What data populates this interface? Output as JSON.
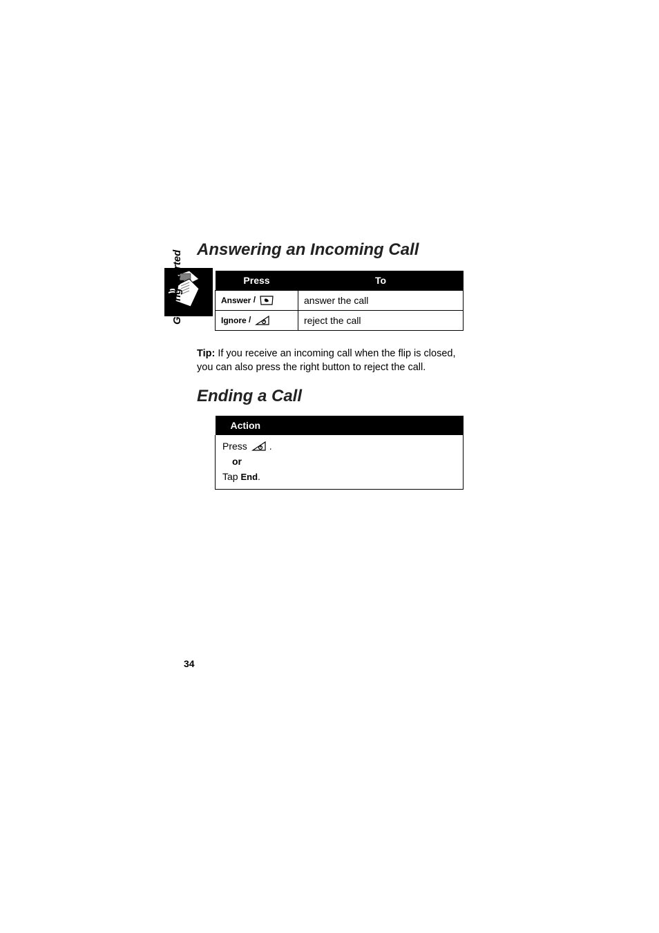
{
  "sidebar": {
    "label": "Getting Started"
  },
  "section1": {
    "heading": "Answering an Incoming Call",
    "table": {
      "header_press": "Press",
      "header_to": "To",
      "rows": [
        {
          "press_label": "Answer",
          "press_sep": " / ",
          "key_icon": "send-key-icon",
          "to": "answer the call"
        },
        {
          "press_label": "Ignore",
          "press_sep": " / ",
          "key_icon": "end-key-icon",
          "to": "reject the call"
        }
      ]
    }
  },
  "tip": {
    "label": "Tip:",
    "text": " If you receive an incoming call when the flip is closed, you can also press the right button to reject the call."
  },
  "section2": {
    "heading": "Ending a Call",
    "table": {
      "header_action": "Action",
      "press_text": "Press ",
      "press_icon": "end-key-icon",
      "press_period": ".",
      "or_text": "or",
      "tap_text": "Tap ",
      "tap_label": "End",
      "tap_period": "."
    }
  },
  "page_number": "34"
}
